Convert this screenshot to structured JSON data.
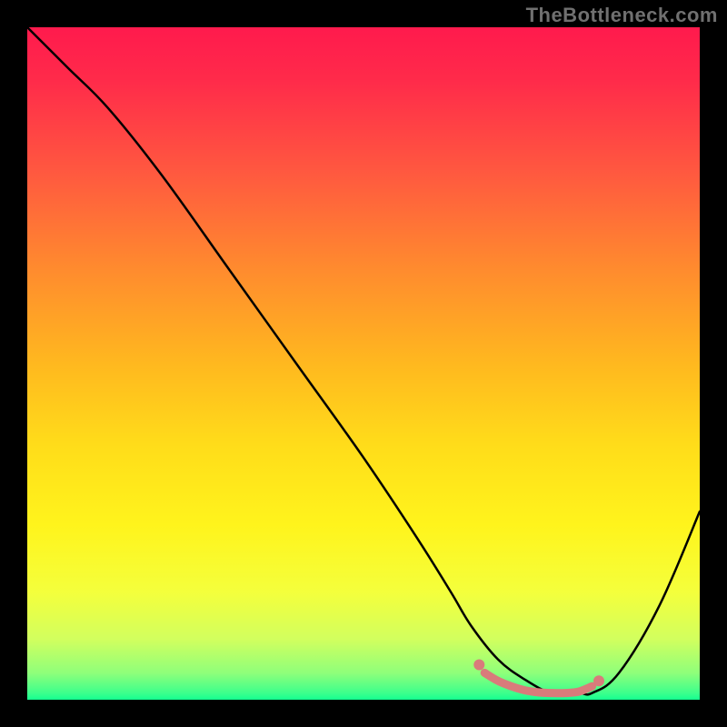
{
  "watermark": "TheBottleneck.com",
  "chart_data": {
    "type": "line",
    "title": "",
    "xlabel": "",
    "ylabel": "",
    "xlim": [
      0,
      100
    ],
    "ylim": [
      0,
      100
    ],
    "series": [
      {
        "name": "curve",
        "color": "#000000",
        "x": [
          0,
          6,
          12,
          20,
          30,
          40,
          50,
          58,
          63,
          66,
          70,
          74,
          78,
          82,
          84,
          88,
          94,
          100
        ],
        "values": [
          100,
          94,
          88,
          78,
          64,
          50,
          36,
          24,
          16,
          11,
          6,
          3,
          1,
          1,
          1,
          4,
          14,
          28
        ]
      },
      {
        "name": "flat-highlight",
        "color": "#d97b7b",
        "x": [
          68,
          70,
          72,
          74,
          76,
          78,
          80,
          82,
          84
        ],
        "values": [
          4,
          2.8,
          2.0,
          1.4,
          1.1,
          1.0,
          1.0,
          1.2,
          2.0
        ]
      },
      {
        "name": "flat-highlight-left-dot",
        "color": "#d97b7b",
        "x": [
          67.2
        ],
        "values": [
          5.2
        ]
      },
      {
        "name": "flat-highlight-right-dot",
        "color": "#d97b7b",
        "x": [
          85.0
        ],
        "values": [
          2.8
        ]
      }
    ],
    "gradient_stops": [
      {
        "pos": 0.0,
        "color": "#ff1a4d"
      },
      {
        "pos": 0.08,
        "color": "#ff2b4a"
      },
      {
        "pos": 0.22,
        "color": "#ff5a3f"
      },
      {
        "pos": 0.36,
        "color": "#ff8b2e"
      },
      {
        "pos": 0.5,
        "color": "#ffb81f"
      },
      {
        "pos": 0.62,
        "color": "#ffdc1a"
      },
      {
        "pos": 0.74,
        "color": "#fff41c"
      },
      {
        "pos": 0.84,
        "color": "#f4ff3c"
      },
      {
        "pos": 0.91,
        "color": "#d2ff5e"
      },
      {
        "pos": 0.96,
        "color": "#8fff7a"
      },
      {
        "pos": 0.99,
        "color": "#3dff8c"
      },
      {
        "pos": 1.0,
        "color": "#15ff90"
      }
    ]
  }
}
